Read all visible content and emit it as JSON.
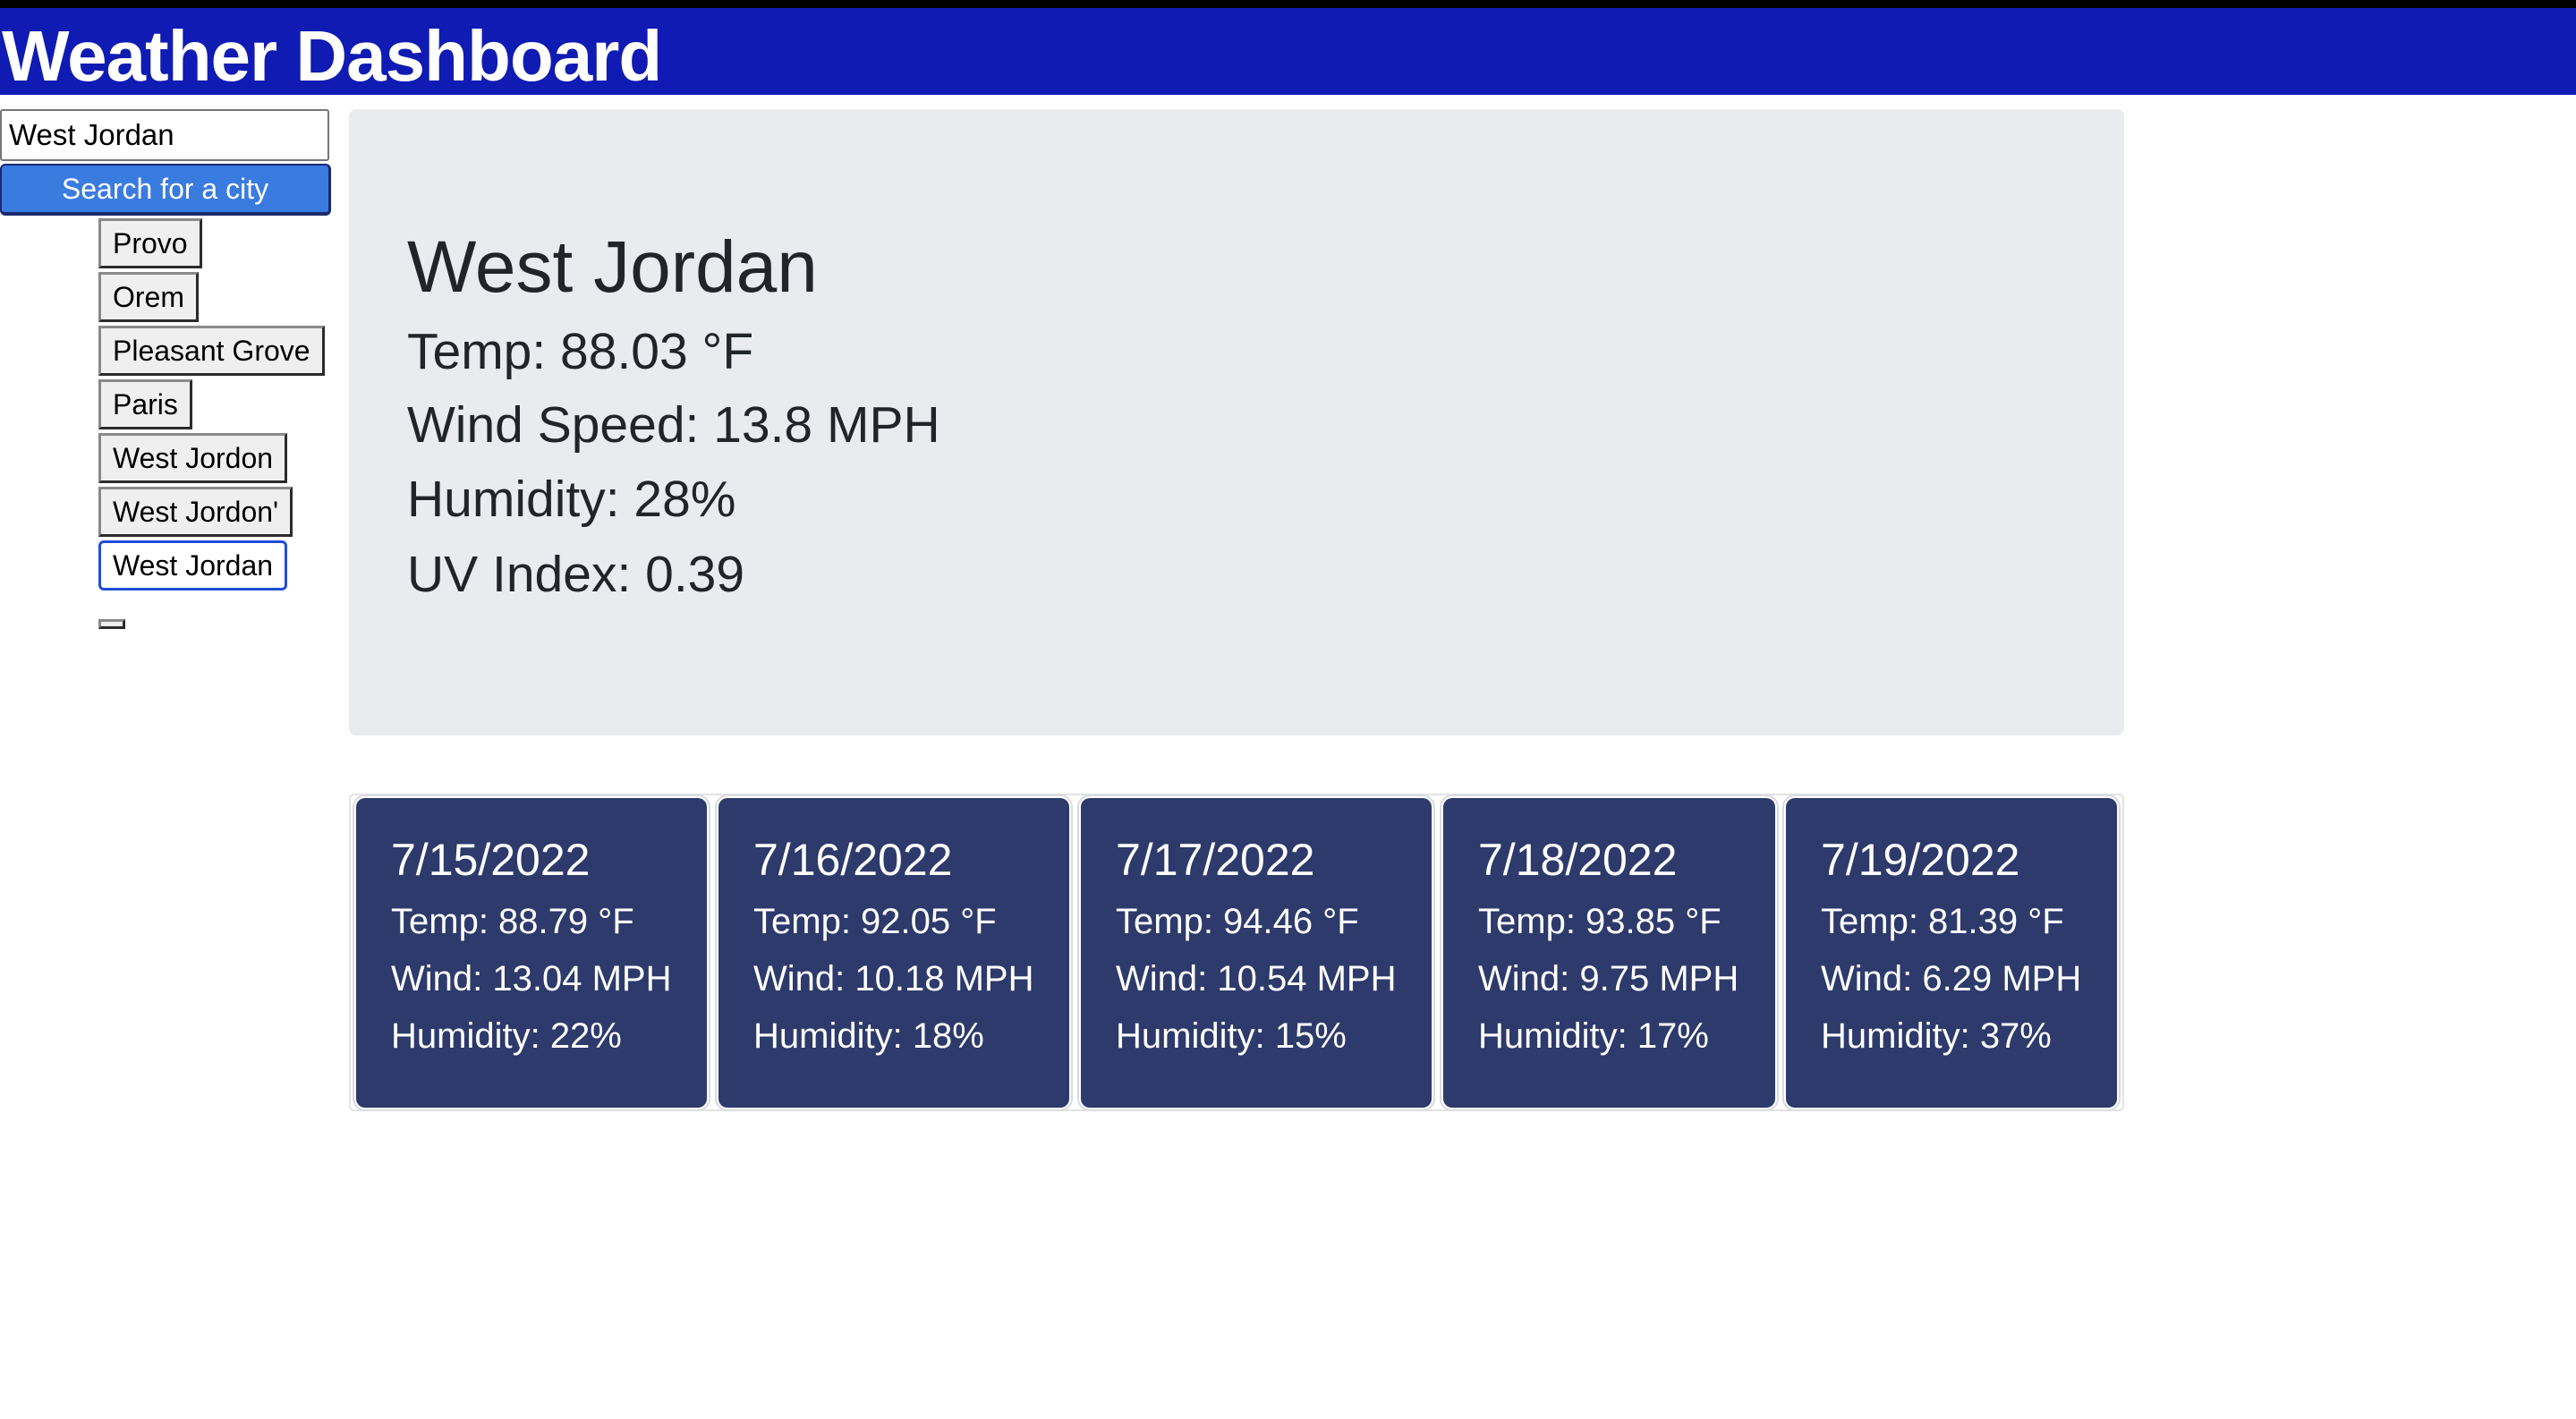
{
  "header": {
    "title": "Weather Dashboard"
  },
  "search": {
    "value": "West Jordan",
    "button_label": "Search for a city"
  },
  "history": [
    {
      "label": "Provo"
    },
    {
      "label": "Orem"
    },
    {
      "label": "Pleasant Grove"
    },
    {
      "label": "Paris"
    },
    {
      "label": "West Jordon"
    },
    {
      "label": "West Jordon'"
    },
    {
      "label": "West Jordan"
    }
  ],
  "current": {
    "city": "West Jordan",
    "temp": "Temp: 88.03 °F",
    "wind": "Wind Speed: 13.8 MPH",
    "humidity": "Humidity: 28%",
    "uv": "UV Index: 0.39"
  },
  "forecast": [
    {
      "date": "7/15/2022",
      "temp": "Temp: 88.79 °F",
      "wind": "Wind: 13.04 MPH",
      "humidity": "Humidity: 22%"
    },
    {
      "date": "7/16/2022",
      "temp": "Temp: 92.05 °F",
      "wind": "Wind: 10.18 MPH",
      "humidity": "Humidity: 18%"
    },
    {
      "date": "7/17/2022",
      "temp": "Temp: 94.46 °F",
      "wind": "Wind: 10.54 MPH",
      "humidity": "Humidity: 15%"
    },
    {
      "date": "7/18/2022",
      "temp": "Temp: 93.85 °F",
      "wind": "Wind: 9.75 MPH",
      "humidity": "Humidity: 17%"
    },
    {
      "date": "7/19/2022",
      "temp": "Temp: 81.39 °F",
      "wind": "Wind: 6.29 MPH",
      "humidity": "Humidity: 37%"
    }
  ],
  "colors": {
    "header_bg": "#0f1bb3",
    "search_button_bg": "#3a7be0",
    "current_panel_bg": "#e9ebef",
    "forecast_card_bg": "#2d3a6b"
  }
}
